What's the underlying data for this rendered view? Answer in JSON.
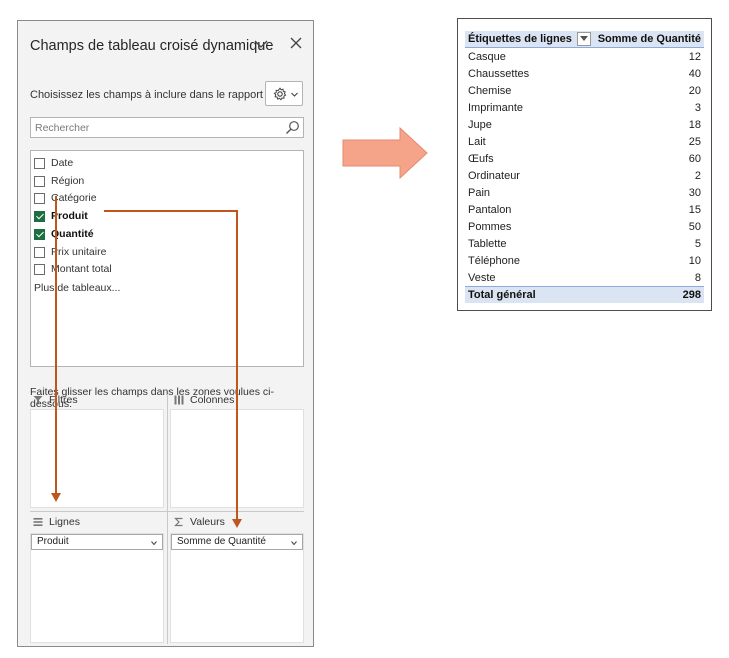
{
  "pane": {
    "title": "Champs de tableau croisé dynamique",
    "choose_label": "Choisissez les champs à inclure dans le rapport :",
    "search_placeholder": "Rechercher",
    "fields": [
      {
        "label": "Date",
        "checked": false
      },
      {
        "label": "Région",
        "checked": false
      },
      {
        "label": "Catégorie",
        "checked": false
      },
      {
        "label": "Produit",
        "checked": true
      },
      {
        "label": "Quantité",
        "checked": true
      },
      {
        "label": "Prix unitaire",
        "checked": false
      },
      {
        "label": "Montant total",
        "checked": false
      }
    ],
    "more_tables": "Plus de tableaux...",
    "drag_label": "Faites glisser les champs dans les zones voulues ci-dessous:",
    "areas": {
      "filters": {
        "label": "Filtres",
        "icon": "filter-icon"
      },
      "columns": {
        "label": "Colonnes",
        "icon": "columns-icon"
      },
      "rows": {
        "label": "Lignes",
        "icon": "rows-icon",
        "item": "Produit"
      },
      "values": {
        "label": "Valeurs",
        "icon": "sigma-icon",
        "item": "Somme de Quantité"
      }
    }
  },
  "pivot": {
    "col_row_labels": "Étiquettes de lignes",
    "col_sum": "Somme de Quantité",
    "rows": [
      {
        "label": "Casque",
        "value": "12"
      },
      {
        "label": "Chaussettes",
        "value": "40"
      },
      {
        "label": "Chemise",
        "value": "20"
      },
      {
        "label": "Imprimante",
        "value": "3"
      },
      {
        "label": "Jupe",
        "value": "18"
      },
      {
        "label": "Lait",
        "value": "25"
      },
      {
        "label": "Œufs",
        "value": "60"
      },
      {
        "label": "Ordinateur",
        "value": "2"
      },
      {
        "label": "Pain",
        "value": "30"
      },
      {
        "label": "Pantalon",
        "value": "15"
      },
      {
        "label": "Pommes",
        "value": "50"
      },
      {
        "label": "Tablette",
        "value": "5"
      },
      {
        "label": "Téléphone",
        "value": "10"
      },
      {
        "label": "Veste",
        "value": "8"
      }
    ],
    "total_label": "Total général",
    "total_value": "298"
  },
  "colors": {
    "annotation_line": "#c0561f",
    "big_arrow_fill": "#f5a48a",
    "checkbox_checked": "#1d6f42",
    "pivot_header_bg": "#dbe4f2"
  }
}
